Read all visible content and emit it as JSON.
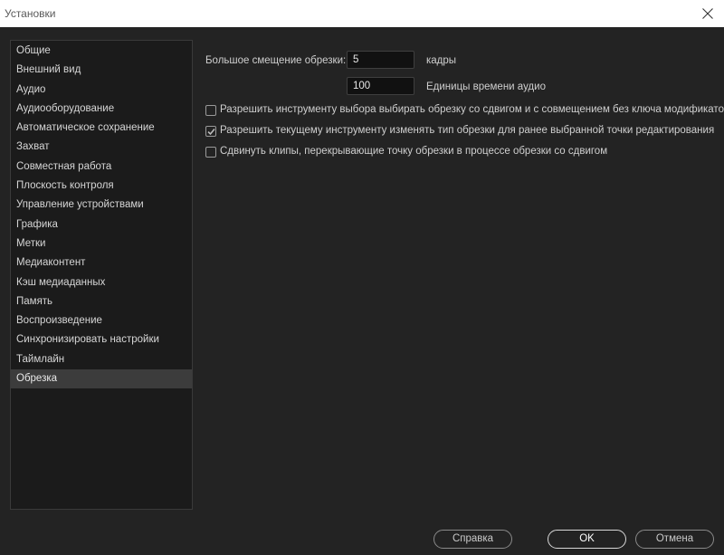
{
  "window": {
    "title": "Установки",
    "close_icon": "close-icon"
  },
  "sidebar": {
    "items": [
      {
        "label": "Общие"
      },
      {
        "label": "Внешний вид"
      },
      {
        "label": "Аудио"
      },
      {
        "label": "Аудиооборудование"
      },
      {
        "label": "Автоматическое сохранение"
      },
      {
        "label": "Захват"
      },
      {
        "label": "Совместная работа"
      },
      {
        "label": "Плоскость контроля"
      },
      {
        "label": "Управление устройствами"
      },
      {
        "label": "Графика"
      },
      {
        "label": "Метки"
      },
      {
        "label": "Медиаконтент"
      },
      {
        "label": "Кэш медиаданных"
      },
      {
        "label": "Память"
      },
      {
        "label": "Воспроизведение"
      },
      {
        "label": "Синхронизировать настройки"
      },
      {
        "label": "Таймлайн"
      },
      {
        "label": "Обрезка"
      }
    ],
    "selected_index": 17
  },
  "trim": {
    "large_offset_label": "Большое смещение обрезки:",
    "frames_value": "5",
    "frames_unit": "кадры",
    "audio_value": "100",
    "audio_unit": "Единицы времени аудио",
    "options": [
      {
        "label": "Разрешить инструменту выбора выбирать обрезку со сдвигом и с совмещением без ключа модификатора",
        "checked": false
      },
      {
        "label": "Разрешить текущему инструменту изменять тип обрезки для ранее выбранной точки редактирования",
        "checked": true
      },
      {
        "label": "Сдвинуть клипы, перекрывающие точку обрезки в процессе обрезки со сдвигом",
        "checked": false
      }
    ]
  },
  "footer": {
    "help_label": "Справка",
    "ok_label": "OK",
    "cancel_label": "Отмена"
  },
  "colors": {
    "background": "#232323",
    "sidebar_background": "#1b1b1b",
    "selected_item": "#3c3c3c",
    "text": "#cfcfcf"
  }
}
